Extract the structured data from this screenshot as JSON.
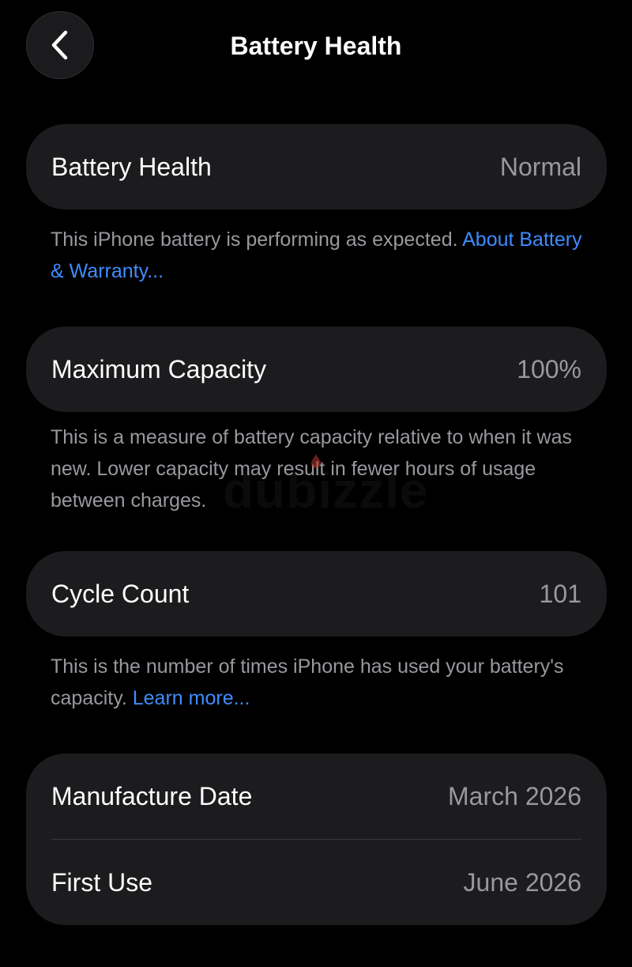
{
  "nav": {
    "title": "Battery Health"
  },
  "battery_health": {
    "label": "Battery Health",
    "value": "Normal",
    "footnote_text": "This iPhone battery is performing as expected. ",
    "footnote_link": "About Battery & Warranty..."
  },
  "maximum_capacity": {
    "label": "Maximum Capacity",
    "value": "100%",
    "footnote_text": "This is a measure of battery capacity relative to when it was new. Lower capacity may result in fewer hours of usage between charges."
  },
  "cycle_count": {
    "label": "Cycle Count",
    "value": "101",
    "footnote_text": "This is the number of times iPhone has used your battery's capacity. ",
    "footnote_link": "Learn more..."
  },
  "dates": {
    "manufacture_label": "Manufacture Date",
    "manufacture_value": "March 2026",
    "first_use_label": "First Use",
    "first_use_value": "June 2026"
  },
  "watermark": {
    "text": "dubizzle"
  },
  "colors": {
    "background": "#000000",
    "card": "#1c1c1e",
    "link": "#3f8cff",
    "secondary_text": "#98989e"
  }
}
